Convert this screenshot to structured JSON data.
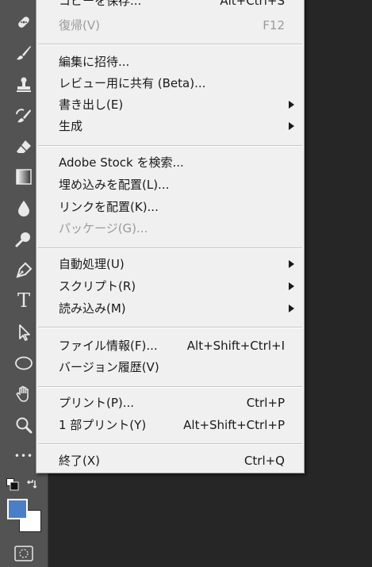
{
  "menu": {
    "items": [
      {
        "label": "コピーを保存...",
        "shortcut": "Alt+Ctrl+S"
      },
      {
        "label": "復帰(V)",
        "shortcut": "F12",
        "disabled": true
      },
      {
        "label": "編集に招待..."
      },
      {
        "label": "レビュー用に共有 (Beta)..."
      },
      {
        "label": "書き出し(E)",
        "submenu": true
      },
      {
        "label": "生成",
        "submenu": true
      },
      {
        "label": "Adobe Stock を検索..."
      },
      {
        "label": "埋め込みを配置(L)..."
      },
      {
        "label": "リンクを配置(K)..."
      },
      {
        "label": "パッケージ(G)...",
        "disabled": true
      },
      {
        "label": "自動処理(U)",
        "submenu": true
      },
      {
        "label": "スクリプト(R)",
        "submenu": true
      },
      {
        "label": "読み込み(M)",
        "submenu": true
      },
      {
        "label": "ファイル情報(F)...",
        "shortcut": "Alt+Shift+Ctrl+I"
      },
      {
        "label": "バージョン履歴(V)"
      },
      {
        "label": "プリント(P)...",
        "shortcut": "Ctrl+P"
      },
      {
        "label": "1 部プリント(Y)",
        "shortcut": "Alt+Shift+Ctrl+P"
      },
      {
        "label": "終了(X)",
        "shortcut": "Ctrl+Q"
      }
    ]
  },
  "toolbar": {
    "tools": [
      "healing-brush-icon",
      "brush-icon",
      "clone-stamp-icon",
      "history-brush-icon",
      "eraser-icon",
      "gradient-icon",
      "blur-drop-icon",
      "dodge-icon",
      "pen-icon",
      "type-icon",
      "path-selection-icon",
      "ellipse-icon",
      "hand-icon",
      "zoom-icon",
      "more-tools-icon"
    ],
    "type_glyph": "T",
    "more_glyph": "•••"
  },
  "colors": {
    "foreground": "#4a7ec6",
    "background": "#ffffff",
    "menu_bg": "#f0f0f0",
    "toolbar_bg": "#535353"
  }
}
